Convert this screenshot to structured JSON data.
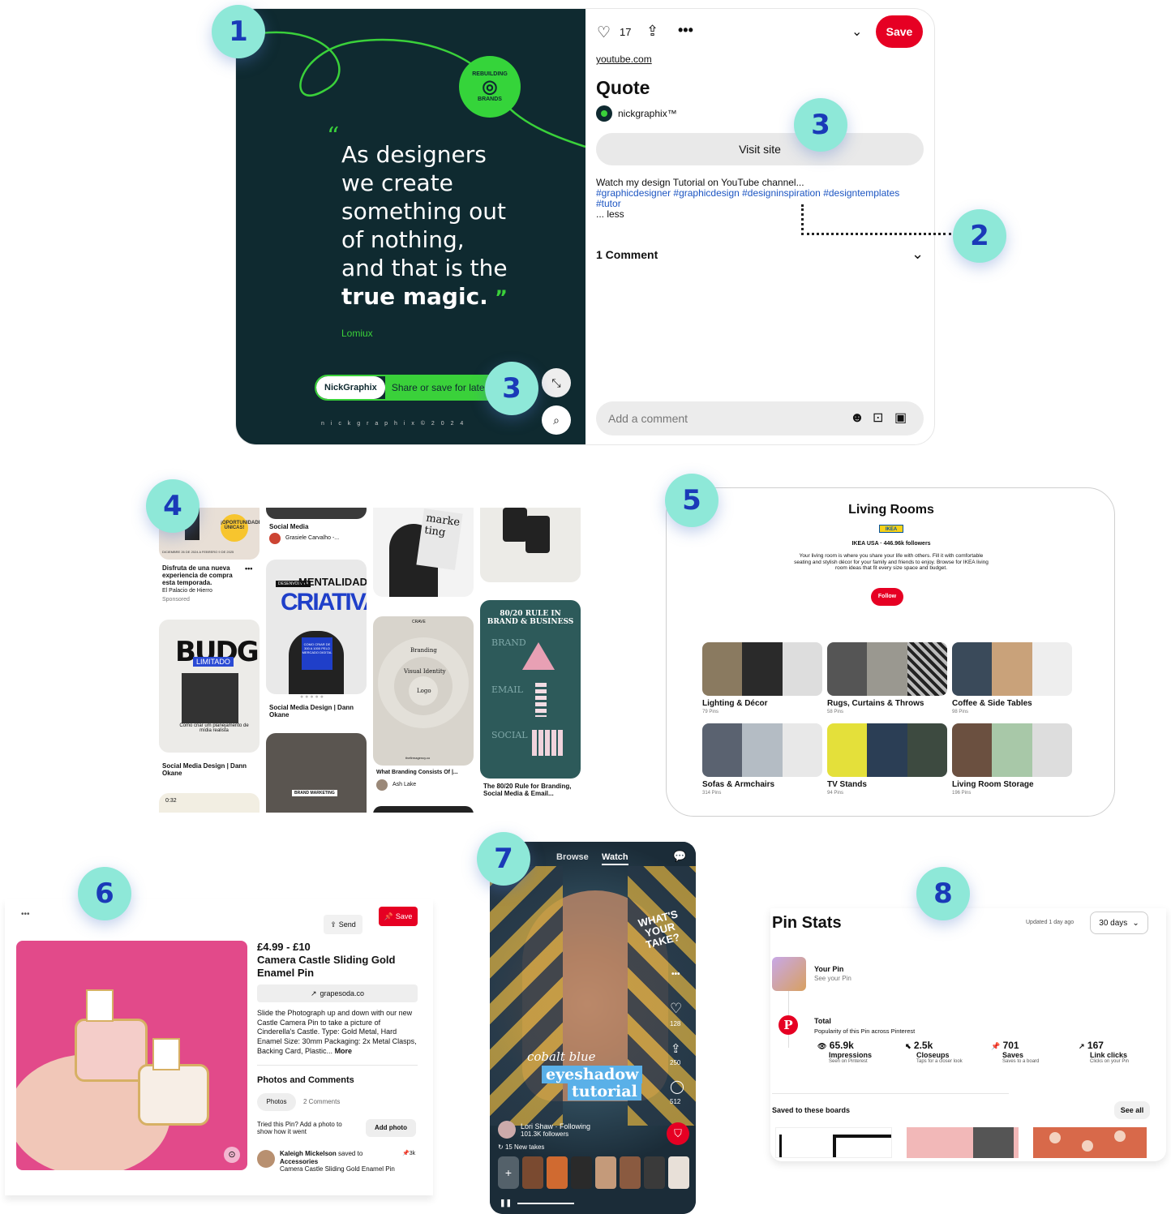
{
  "badges": [
    "1",
    "2",
    "3",
    "3",
    "4",
    "5",
    "6",
    "7",
    "8"
  ],
  "pin": {
    "quote_lines": [
      "As designers",
      "we create",
      "something out",
      "of nothing,",
      "and that is the"
    ],
    "quote_bold": "true magic.",
    "author": "Lomiux",
    "cta_brand": "NickGraphix",
    "cta_text": "Share or save for later",
    "footer_text": "n i c k g r a p h i x © 2 0 2 4",
    "circle_text_top": "REBUILDING",
    "circle_text_bottom": "BRANDS",
    "likes": "17",
    "save_label": "Save",
    "source": "youtube.com",
    "title": "Quote",
    "author_name": "nickgraphix™",
    "visit_label": "Visit site",
    "desc": "Watch my design Tutorial on YouTube channel...",
    "tags": "#graphicdesigner #graphicdesign #designinspiration #designtemplates",
    "tags2": "#tutor",
    "less": "... less",
    "comments_label": "1 Comment",
    "comment_placeholder": "Add a comment"
  },
  "feed": {
    "c1_title": "Disfruta de una nueva experiencia de compra esta temporada.",
    "c1_store": "El Palacio de Hierro",
    "c1_sponsored": "Sponsored",
    "c1_banner": "DICIEMBRE 26 DE 2024 A FEBRERO 9 DE 2025",
    "c1_badge": "¡OPORTUNIDADES ÚNICAS!",
    "budget_word": "BUDGET",
    "budget_tag": "LIMITADO",
    "budget_caption": "Como criar um planejamento de mídia realista",
    "c1b_title": "Social Media Design | Dann Okane",
    "video_time": "0:32",
    "c2_top_title": "Social Media",
    "c2_top_user": "Grasiele Carvalho -...",
    "crea_tag": "DESENVOLVA A",
    "crea_word1": "MENTALIDADE",
    "crea_word2": "CRIATIVA",
    "crea_face": "COMO CRIAR DE 300 A 1000 PELO MERCADO DIGITAL",
    "c2_title": "Social Media Design | Dann Okane",
    "c2b_tag": "BRAND MARKETING",
    "c3_mag": "marke ting",
    "c3_title": "What Branding Consists Of |...",
    "c3_user": "Ash Lake",
    "brand_center": "Logo",
    "brand_ring": "Visual Identity",
    "brand_outer": "Branding",
    "brand_top": "CRAVE",
    "brand_site": "thefirmagency.co",
    "c4_heading": "80/20 RULE IN BRAND & BUSINESS",
    "c4_labels": [
      "BRAND",
      "EMAIL",
      "SOCIAL"
    ],
    "c4_title": "The 80/20 Rule for Branding, Social Media & Email..."
  },
  "board": {
    "title": "Living Rooms",
    "logo": "IKEA",
    "owner": "IKEA USA · 446.96k followers",
    "desc": "Your living room is where you share your life with others. Fill it with comfortable seating and stylish décor for your family and friends to enjoy. Browse for IKEA living room ideas that fit every size space and budget.",
    "follow": "Follow",
    "sections": [
      {
        "title": "Lighting & Décor",
        "pins": "79 Pins"
      },
      {
        "title": "Rugs, Curtains & Throws",
        "pins": "58 Pins"
      },
      {
        "title": "Coffee & Side Tables",
        "pins": "98 Pins"
      },
      {
        "title": "Sofas & Armchairs",
        "pins": "314 Pins"
      },
      {
        "title": "TV Stands",
        "pins": "94 Pins"
      },
      {
        "title": "Living Room Storage",
        "pins": "196 Pins"
      }
    ]
  },
  "product": {
    "send": "Send",
    "save": "Save",
    "price": "£4.99 - £10",
    "title": "Camera Castle Sliding Gold Enamel Pin",
    "link": "grapesoda.co",
    "desc": "Slide the Photograph up and down with our new Castle Camera Pin to take a picture of Cinderella's Castle. Type: Gold Metal, Hard Enamel Size: 30mm Packaging: 2x Metal Clasps, Backing Card, Plastic...",
    "more": "More",
    "photos_heading": "Photos and Comments",
    "tab_photos": "Photos",
    "tab_comments": "2 Comments",
    "tried": "Tried this Pin? Add a photo to show how it went",
    "add_photo": "Add photo",
    "saver_name": "Kaleigh Mickelson",
    "saver_mid": "saved to",
    "saver_board": "Accessories",
    "saver_pin": "Camera Castle Sliding Gold Enamel Pin",
    "saver_count": "3k"
  },
  "video": {
    "tab_browse": "Browse",
    "tab_watch": "Watch",
    "sticker": "WHAT'S YOUR TAKE?",
    "caption1": "cobalt blue",
    "caption2": "eyeshadow",
    "caption3": "tutorial",
    "likes": "128",
    "shares": "250",
    "comments": "512",
    "creator": "Lori Shaw · Following",
    "followers": "101.3K followers",
    "takes": "15 New takes",
    "plus": "+"
  },
  "stats": {
    "title": "Pin Stats",
    "updated": "Updated 1 day ago",
    "range": "30 days",
    "your_pin": "Your Pin",
    "see_pin": "See your Pin",
    "total": "Total",
    "total_sub": "Popularity of this Pin across Pinterest",
    "metrics": [
      {
        "icon": "👁",
        "value": "65.9k",
        "label": "Impressions",
        "sub": "Seen on Pinterest"
      },
      {
        "icon": "⬉",
        "value": "2.5k",
        "label": "Closeups",
        "sub": "Taps for a closer look"
      },
      {
        "icon": "📌",
        "value": "701",
        "label": "Saves",
        "sub": "Saves to a board"
      },
      {
        "icon": "↗",
        "value": "167",
        "label": "Link clicks",
        "sub": "Clicks on your Pin"
      }
    ],
    "boards_label": "Saved to these boards",
    "see_all": "See all"
  }
}
